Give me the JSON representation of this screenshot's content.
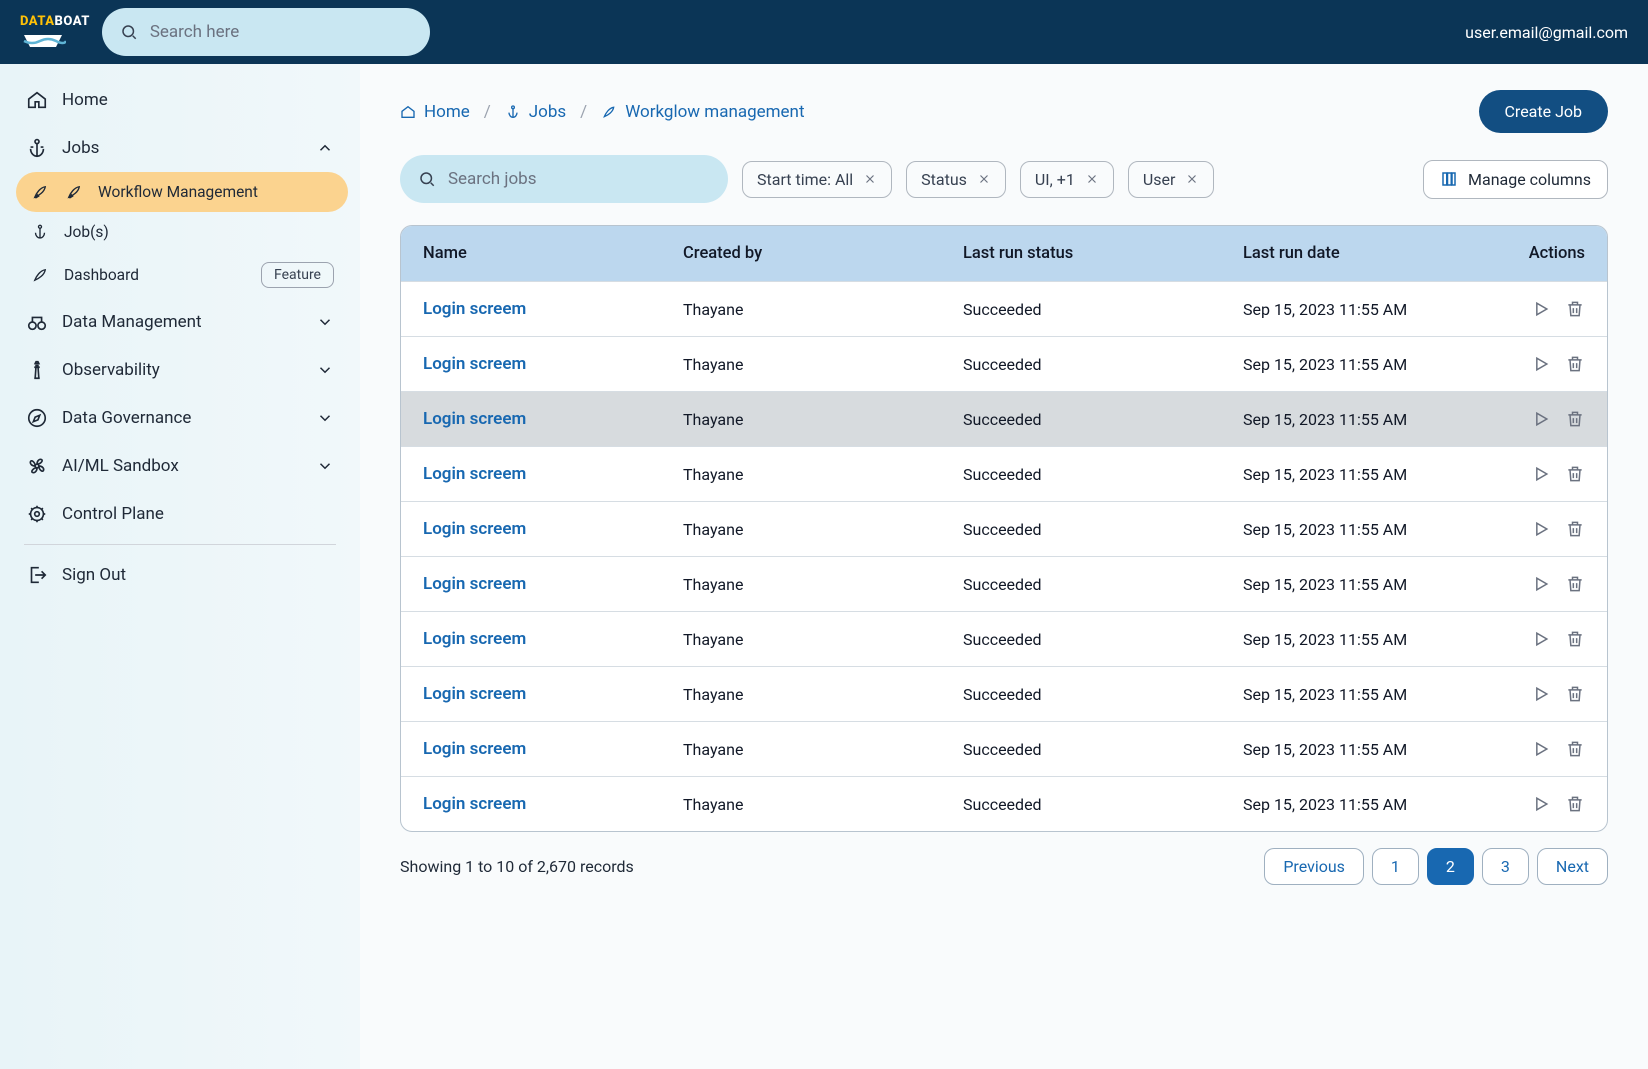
{
  "header": {
    "logo_part1": "DATA",
    "logo_part2": "BOAT",
    "search_placeholder": "Search here",
    "user_email": "user.email@gmail.com"
  },
  "sidebar": {
    "home": "Home",
    "jobs": "Jobs",
    "jobs_children": {
      "workflow": "Workflow Management",
      "jobs": "Job(s)",
      "dashboard": "Dashboard",
      "dashboard_badge": "Feature"
    },
    "data_mgmt": "Data Management",
    "observability": "Observability",
    "governance": "Data Governance",
    "aiml": "AI/ML Sandbox",
    "control": "Control Plane",
    "signout": "Sign Out"
  },
  "breadcrumb": {
    "home": "Home",
    "jobs": "Jobs",
    "current": "Workglow management"
  },
  "actions": {
    "create": "Create Job",
    "manage_cols": "Manage columns"
  },
  "filters": {
    "search_placeholder": "Search jobs",
    "start": "Start time: All",
    "status": "Status",
    "ui": "UI, +1",
    "user": "User"
  },
  "columns": {
    "name": "Name",
    "by": "Created by",
    "status": "Last run status",
    "date": "Last run date",
    "actions": "Actions"
  },
  "rows": [
    {
      "name": "Login screem",
      "by": "Thayane",
      "status": "Succeeded",
      "date": "Sep 15, 2023 11:55 AM"
    },
    {
      "name": "Login screem",
      "by": "Thayane",
      "status": "Succeeded",
      "date": "Sep 15, 2023 11:55 AM"
    },
    {
      "name": "Login screem",
      "by": "Thayane",
      "status": "Succeeded",
      "date": "Sep 15, 2023 11:55 AM"
    },
    {
      "name": "Login screem",
      "by": "Thayane",
      "status": "Succeeded",
      "date": "Sep 15, 2023 11:55 AM"
    },
    {
      "name": "Login screem",
      "by": "Thayane",
      "status": "Succeeded",
      "date": "Sep 15, 2023 11:55 AM"
    },
    {
      "name": "Login screem",
      "by": "Thayane",
      "status": "Succeeded",
      "date": "Sep 15, 2023 11:55 AM"
    },
    {
      "name": "Login screem",
      "by": "Thayane",
      "status": "Succeeded",
      "date": "Sep 15, 2023 11:55 AM"
    },
    {
      "name": "Login screem",
      "by": "Thayane",
      "status": "Succeeded",
      "date": "Sep 15, 2023 11:55 AM"
    },
    {
      "name": "Login screem",
      "by": "Thayane",
      "status": "Succeeded",
      "date": "Sep 15, 2023 11:55 AM"
    },
    {
      "name": "Login screem",
      "by": "Thayane",
      "status": "Succeeded",
      "date": "Sep 15, 2023 11:55 AM"
    }
  ],
  "hover_index": 2,
  "footer": {
    "summary": "Showing 1 to 10 of 2,670 records",
    "prev": "Previous",
    "next": "Next",
    "pages": [
      "1",
      "2",
      "3"
    ],
    "active": 1
  }
}
